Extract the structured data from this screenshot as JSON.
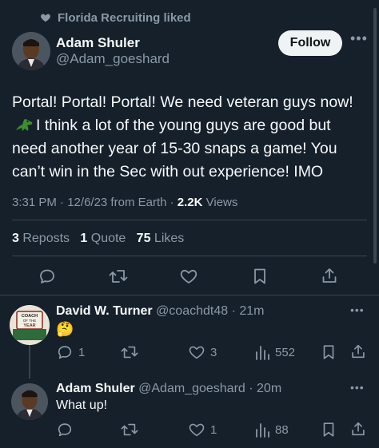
{
  "social_context": {
    "text": "Florida Recruiting liked",
    "icon": "heart-icon"
  },
  "tweet": {
    "author_name": "Adam Shuler",
    "author_handle": "@Adam_goeshard",
    "follow_label": "Follow",
    "text_part1": "Portal! Portal! Portal!  We need veteran guys now!",
    "text_part2": "I think a lot of the young guys are good but need another year of 15-30 snaps a game!  You can’t win in the Sec with out experience! IMO",
    "emoji": "crocodile",
    "time": "3:31 PM",
    "sep1": " · ",
    "date": "12/6/23",
    "source": " from Earth",
    "sep2": " · ",
    "views_count": "2.2K",
    "views_label": " Views",
    "reposts_count": "3",
    "reposts_label": " Reposts",
    "quotes_count": "1",
    "quotes_label": " Quote",
    "likes_count": "75",
    "likes_label": " Likes"
  },
  "replies": [
    {
      "author_name": "David W. Turner",
      "author_handle": "@coachdt48",
      "time": " · 21m",
      "text": "🤔",
      "avatar_text": [
        "COACH",
        "OF THE",
        "YEAR"
      ],
      "reply_count": "1",
      "repost_count": "",
      "like_count": "3",
      "views_count": "552"
    },
    {
      "author_name": "Adam Shuler",
      "author_handle": "@Adam_goeshard",
      "time": " · 20m",
      "text": "What up!",
      "reply_count": "",
      "repost_count": "",
      "like_count": "1",
      "views_count": "88"
    }
  ],
  "colors": {
    "background": "#15202b",
    "text": "#f7f9f9",
    "muted": "#8b98a5",
    "divider": "#38444d",
    "follow_bg": "#eff3f4"
  }
}
